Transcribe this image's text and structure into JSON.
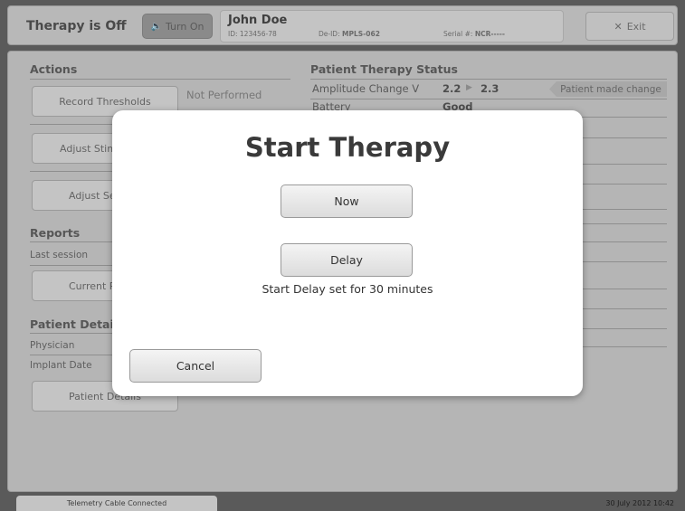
{
  "header": {
    "therapy_status": "Therapy is Off",
    "turn_on_label": "Turn On",
    "patient_name": "John Doe",
    "patient_id": "ID: 123456-78",
    "deid_label": "De-ID:",
    "deid_value": "MPLS-062",
    "serial_label": "Serial #:",
    "serial_value": "NCR-----",
    "exit_label": "Exit"
  },
  "actions": {
    "title": "Actions",
    "record_thresholds_label": "Record Thresholds",
    "record_thresholds_status": "Not Performed",
    "adjust_stim_label": "Adjust Stim",
    "adjust_se_label": "Adjust Se"
  },
  "reports": {
    "title": "Reports",
    "last_session_label": "Last session",
    "current_button_label": "Current R"
  },
  "patient_details": {
    "title": "Patient Detail",
    "physician_label": "Physician",
    "implant_date_label": "Implant Date",
    "button_label": "Patient Details"
  },
  "status": {
    "title": "Patient Therapy Status",
    "amplitude_label": "Amplitude Change V",
    "amplitude_from": "2.2",
    "amplitude_to": "2.3",
    "change_badge": "Patient made change",
    "battery_label": "Battery",
    "battery_value": "Good"
  },
  "footer": {
    "telemetry": "Telemetry Cable Connected",
    "datetime": "30 July 2012 10:42"
  },
  "modal": {
    "title": "Start Therapy",
    "now_label": "Now",
    "delay_label": "Delay",
    "delay_note": "Start Delay set for 30 minutes",
    "cancel_label": "Cancel"
  },
  "icons": {
    "speaker": "speaker-icon",
    "close": "close-icon",
    "arrow": "arrow-right-icon"
  }
}
